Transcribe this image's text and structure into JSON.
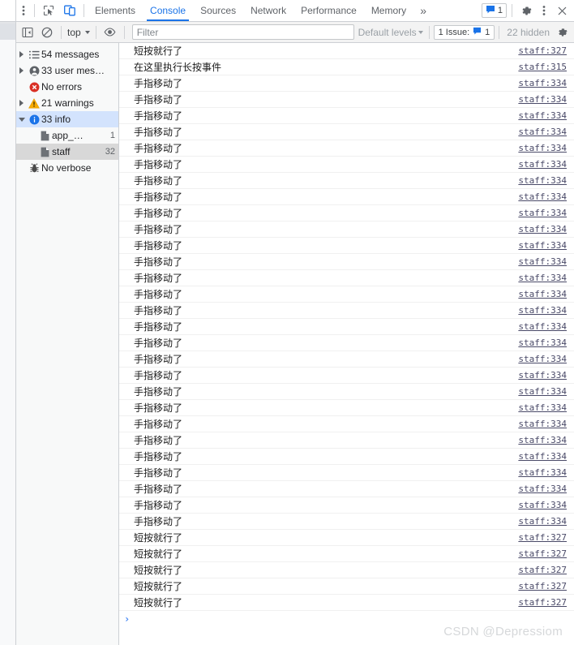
{
  "window": {
    "tabbar": {
      "kebab_icon": "vertical-dots-icon",
      "inspect_icon": "inspect-element-icon",
      "device_icon": "device-toolbar-icon",
      "tabs": [
        {
          "label": "Elements",
          "active": false
        },
        {
          "label": "Console",
          "active": true
        },
        {
          "label": "Sources",
          "active": false
        },
        {
          "label": "Network",
          "active": false
        },
        {
          "label": "Performance",
          "active": false
        },
        {
          "label": "Memory",
          "active": false
        }
      ],
      "more_tabs_label": "»",
      "issues_badge": {
        "icon": "issue-message-icon",
        "count": "1"
      },
      "settings_icon": "gear-icon",
      "menu_icon": "vertical-dots-icon",
      "close_label": "✕"
    },
    "filterbar": {
      "sidebar_toggle_icon": "console-sidebar-toggle-icon",
      "clear_icon": "clear-console-icon",
      "context_label": "top",
      "eye_icon": "live-expression-icon",
      "filter_placeholder": "Filter",
      "filter_value": "",
      "levels_label": "Default levels",
      "issue_pill_label": "1 Issue:",
      "issue_pill_count": "1",
      "hidden_label": "22 hidden",
      "settings_icon": "gear-icon"
    }
  },
  "sidebar": {
    "items": [
      {
        "label": "54 messages",
        "icon": "list-icon",
        "expandable": true,
        "expanded": false,
        "count": "",
        "child": false,
        "state": "normal"
      },
      {
        "label": "33 user mes…",
        "icon": "user-icon",
        "expandable": true,
        "expanded": false,
        "count": "",
        "child": false,
        "state": "normal"
      },
      {
        "label": "No errors",
        "icon": "error-icon",
        "expandable": false,
        "expanded": false,
        "count": "",
        "child": false,
        "state": "normal"
      },
      {
        "label": "21 warnings",
        "icon": "warning-icon",
        "expandable": true,
        "expanded": false,
        "count": "",
        "child": false,
        "state": "normal"
      },
      {
        "label": "33 info",
        "icon": "info-icon",
        "expandable": true,
        "expanded": true,
        "count": "",
        "child": false,
        "state": "selected"
      },
      {
        "label": "app_…",
        "icon": "file-icon",
        "expandable": false,
        "expanded": false,
        "count": "1",
        "child": true,
        "state": "normal"
      },
      {
        "label": "staff",
        "icon": "file-icon",
        "expandable": false,
        "expanded": false,
        "count": "32",
        "child": true,
        "state": "hover"
      },
      {
        "label": "No verbose",
        "icon": "bug-icon",
        "expandable": false,
        "expanded": false,
        "count": "",
        "child": false,
        "state": "normal"
      }
    ]
  },
  "console": {
    "rows": [
      {
        "text": "短按就行了",
        "source": "staff:327"
      },
      {
        "text": "在这里执行长按事件",
        "source": "staff:315"
      },
      {
        "text": "手指移动了",
        "source": "staff:334"
      },
      {
        "text": "手指移动了",
        "source": "staff:334"
      },
      {
        "text": "手指移动了",
        "source": "staff:334"
      },
      {
        "text": "手指移动了",
        "source": "staff:334"
      },
      {
        "text": "手指移动了",
        "source": "staff:334"
      },
      {
        "text": "手指移动了",
        "source": "staff:334"
      },
      {
        "text": "手指移动了",
        "source": "staff:334"
      },
      {
        "text": "手指移动了",
        "source": "staff:334"
      },
      {
        "text": "手指移动了",
        "source": "staff:334"
      },
      {
        "text": "手指移动了",
        "source": "staff:334"
      },
      {
        "text": "手指移动了",
        "source": "staff:334"
      },
      {
        "text": "手指移动了",
        "source": "staff:334"
      },
      {
        "text": "手指移动了",
        "source": "staff:334"
      },
      {
        "text": "手指移动了",
        "source": "staff:334"
      },
      {
        "text": "手指移动了",
        "source": "staff:334"
      },
      {
        "text": "手指移动了",
        "source": "staff:334"
      },
      {
        "text": "手指移动了",
        "source": "staff:334"
      },
      {
        "text": "手指移动了",
        "source": "staff:334"
      },
      {
        "text": "手指移动了",
        "source": "staff:334"
      },
      {
        "text": "手指移动了",
        "source": "staff:334"
      },
      {
        "text": "手指移动了",
        "source": "staff:334"
      },
      {
        "text": "手指移动了",
        "source": "staff:334"
      },
      {
        "text": "手指移动了",
        "source": "staff:334"
      },
      {
        "text": "手指移动了",
        "source": "staff:334"
      },
      {
        "text": "手指移动了",
        "source": "staff:334"
      },
      {
        "text": "手指移动了",
        "source": "staff:334"
      },
      {
        "text": "手指移动了",
        "source": "staff:334"
      },
      {
        "text": "手指移动了",
        "source": "staff:334"
      },
      {
        "text": "短按就行了",
        "source": "staff:327"
      },
      {
        "text": "短按就行了",
        "source": "staff:327"
      },
      {
        "text": "短按就行了",
        "source": "staff:327"
      },
      {
        "text": "短按就行了",
        "source": "staff:327"
      },
      {
        "text": "短按就行了",
        "source": "staff:327"
      }
    ],
    "prompt_caret": "›",
    "prompt_value": ""
  },
  "watermark": {
    "text": "CSDN @Depressiom"
  },
  "colors": {
    "accent": "#1a73e8",
    "selected_row": "#d3e3fd",
    "hover_row": "#d8d8d8",
    "error": "#d93025",
    "warning": "#f9ab00",
    "info": "#1a73e8",
    "link": "#4a4a68",
    "toolbar_bg": "#f3f3f3",
    "sidebar_bg": "#f8f9f9"
  }
}
